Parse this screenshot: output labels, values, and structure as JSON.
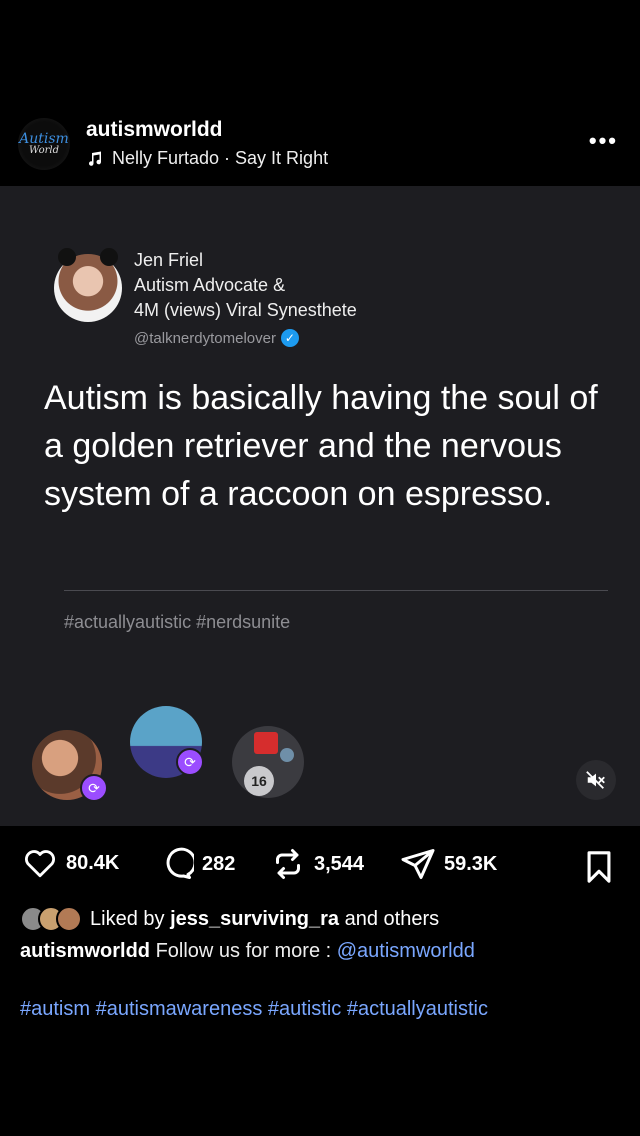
{
  "header": {
    "account_avatar_line1": "Autism",
    "account_avatar_line2": "World",
    "username": "autismworldd",
    "audio": "Nelly Furtado · Say It Right",
    "more_label": "•••"
  },
  "post": {
    "author_name": "Jen Friel",
    "author_bio_line1": "Autism Advocate &",
    "author_bio_line2": "4M (views) Viral Synesthete",
    "author_handle": "@talknerdytomelover",
    "quote": "Autism is basically having the soul of a golden retriever and the nervous system of a raccoon on espresso.",
    "hashtags": "#actuallyautistic #nerdsunite",
    "repost_count_badge": "16"
  },
  "actions": {
    "likes": "80.4K",
    "comments": "282",
    "reposts": "3,544",
    "shares": "59.3K"
  },
  "liked_by": {
    "prefix": "Liked by ",
    "user": "jess_surviving_ra",
    "suffix": " and others"
  },
  "caption": {
    "username": "autismworldd",
    "text": " Follow us for more : ",
    "mention": "@autismworldd"
  },
  "hashtags": "#autism #autismawareness #autistic #actuallyautistic",
  "colors": {
    "background": "#000000",
    "card": "#1d1d21",
    "link": "#7aa7ff",
    "repost_badge": "#9b4dff",
    "verified": "#1d9bf0"
  }
}
